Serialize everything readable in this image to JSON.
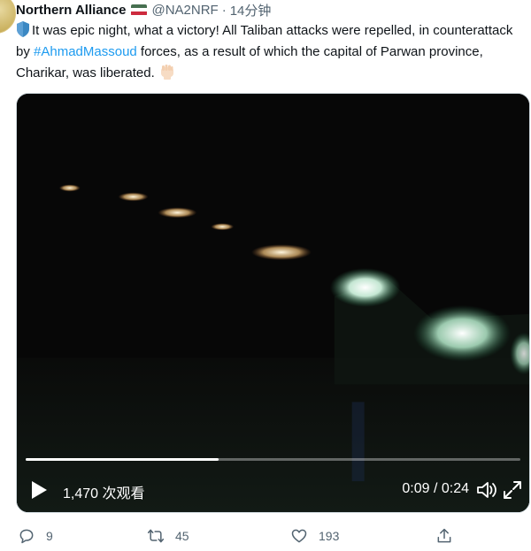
{
  "tweet": {
    "author_name": "Northern Alliance",
    "handle": "@NA2NRF",
    "separator": "·",
    "time": "14分钟",
    "text_part1": "It was epic night, what a victory! All Taliban attacks were repelled, in counterattack by ",
    "hashtag": "#AhmadMassoud",
    "text_part2": " forces, as a result of which the capital of Parwan province, Charikar, was liberated."
  },
  "video": {
    "views": "1,470 次观看",
    "timecode": "0:09 / 0:24",
    "progress": 0.39
  },
  "actions": {
    "replies": "9",
    "retweets": "45",
    "likes": "193"
  },
  "icons": {
    "flag": "flag-emoji",
    "shield": "shield-emoji",
    "fist": "raised-fist-emoji",
    "play": "play-icon",
    "volume": "volume-icon",
    "fullscreen": "fullscreen-icon",
    "reply": "reply-icon",
    "retweet": "retweet-icon",
    "like": "heart-icon",
    "share": "share-icon"
  },
  "colors": {
    "hashtag": "#1d9bf0",
    "secondary_text": "#536471",
    "video_background": "#060606"
  }
}
